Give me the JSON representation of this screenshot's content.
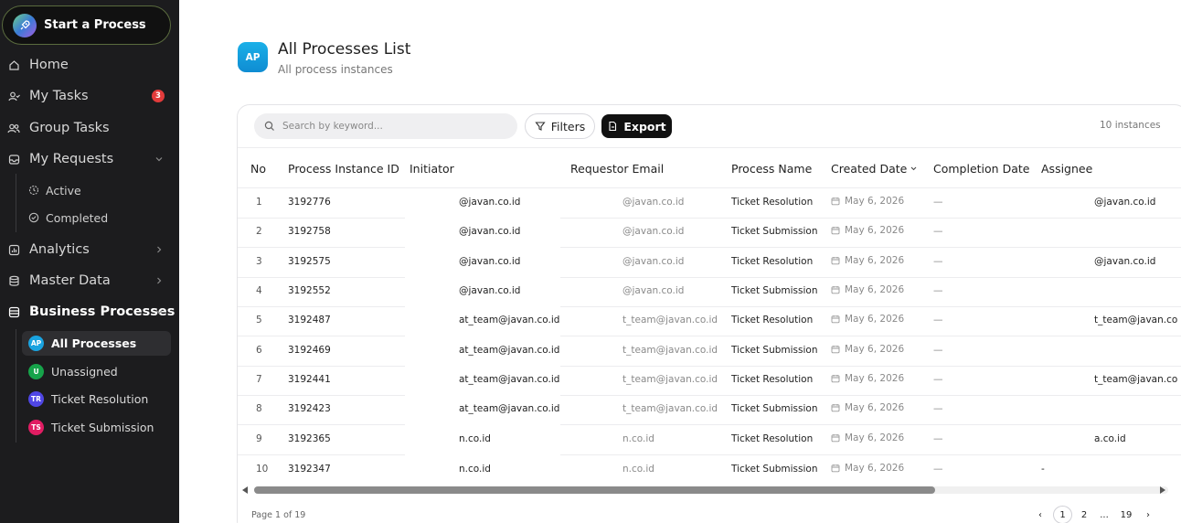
{
  "sidebar": {
    "start_label": "Start a Process",
    "home": "Home",
    "my_tasks": "My Tasks",
    "my_tasks_badge": "3",
    "group_tasks": "Group Tasks",
    "my_requests": "My Requests",
    "active": "Active",
    "completed": "Completed",
    "analytics": "Analytics",
    "master_data": "Master Data",
    "business_processes": "Business Processes",
    "bp_items": [
      {
        "chip": "AP",
        "label": "All Processes",
        "color": "#1aa3e0"
      },
      {
        "chip": "U",
        "label": "Unassigned",
        "color": "#16a34a"
      },
      {
        "chip": "TR",
        "label": "Ticket Resolution",
        "color": "#4f46e5"
      },
      {
        "chip": "TS",
        "label": "Ticket Submission",
        "color": "#e11d63"
      }
    ]
  },
  "header": {
    "tile": "AP",
    "title": "All Processes List",
    "subtitle": "All process instances"
  },
  "toolbar": {
    "search_placeholder": "Search by keyword...",
    "filters_label": "Filters",
    "export_label": "Export",
    "count": "10 instances"
  },
  "table": {
    "columns": [
      "No",
      "Process Instance ID",
      "Initiator",
      "Requestor Email",
      "Process Name",
      "Created Date",
      "Completion Date",
      "Assignee"
    ],
    "rows": [
      {
        "no": "1",
        "id": "3192776",
        "initiator": "@javan.co.id",
        "requestor": "@javan.co.id",
        "process": "Ticket Resolution",
        "created": "May 6, 2026",
        "completion": "—",
        "assignee": "@javan.co.id"
      },
      {
        "no": "2",
        "id": "3192758",
        "initiator": "@javan.co.id",
        "requestor": "@javan.co.id",
        "process": "Ticket Submission",
        "created": "May 6, 2026",
        "completion": "—",
        "assignee": ""
      },
      {
        "no": "3",
        "id": "3192575",
        "initiator": "@javan.co.id",
        "requestor": "@javan.co.id",
        "process": "Ticket Resolution",
        "created": "May 6, 2026",
        "completion": "—",
        "assignee": "@javan.co.id"
      },
      {
        "no": "4",
        "id": "3192552",
        "initiator": "@javan.co.id",
        "requestor": "@javan.co.id",
        "process": "Ticket Submission",
        "created": "May 6, 2026",
        "completion": "—",
        "assignee": ""
      },
      {
        "no": "5",
        "id": "3192487",
        "initiator": "at_team@javan.co.id",
        "requestor": "t_team@javan.co.id",
        "process": "Ticket Resolution",
        "created": "May 6, 2026",
        "completion": "—",
        "assignee": "t_team@javan.co"
      },
      {
        "no": "6",
        "id": "3192469",
        "initiator": "at_team@javan.co.id",
        "requestor": "t_team@javan.co.id",
        "process": "Ticket Submission",
        "created": "May 6, 2026",
        "completion": "—",
        "assignee": ""
      },
      {
        "no": "7",
        "id": "3192441",
        "initiator": "at_team@javan.co.id",
        "requestor": "t_team@javan.co.id",
        "process": "Ticket Resolution",
        "created": "May 6, 2026",
        "completion": "—",
        "assignee": "t_team@javan.co"
      },
      {
        "no": "8",
        "id": "3192423",
        "initiator": "at_team@javan.co.id",
        "requestor": "t_team@javan.co.id",
        "process": "Ticket Submission",
        "created": "May 6, 2026",
        "completion": "—",
        "assignee": ""
      },
      {
        "no": "9",
        "id": "3192365",
        "initiator": "n.co.id",
        "requestor": "n.co.id",
        "process": "Ticket Resolution",
        "created": "May 6, 2026",
        "completion": "—",
        "assignee": "a.co.id"
      },
      {
        "no": "10",
        "id": "3192347",
        "initiator": "n.co.id",
        "requestor": "n.co.id",
        "process": "Ticket Submission",
        "created": "May 6, 2026",
        "completion": "—",
        "assignee": "-"
      }
    ]
  },
  "pager": {
    "text": "Page 1 of 19",
    "prev": "‹",
    "next": "›",
    "pages": [
      "1",
      "2",
      "...",
      "19"
    ]
  }
}
